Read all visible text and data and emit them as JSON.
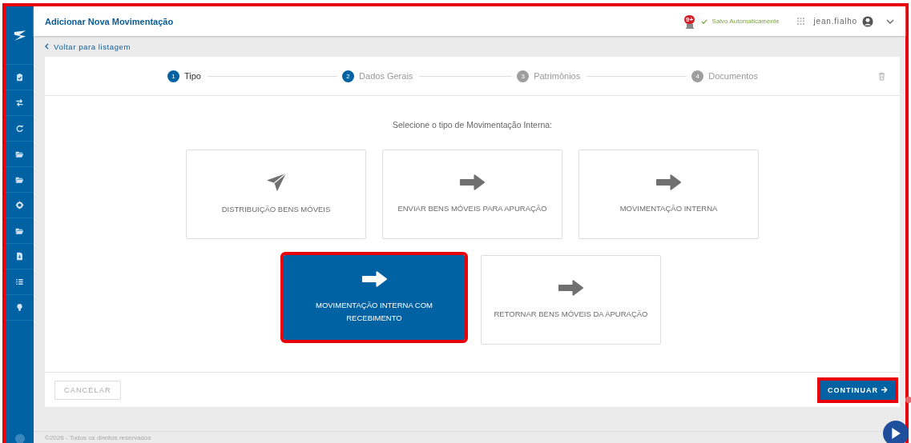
{
  "annotated": true,
  "header": {
    "title": "Adicionar Nova Movimentação",
    "notification_badge": "9+",
    "save_status": "Salvo Automaticamente",
    "username": "jean.fialho"
  },
  "back_link": "Voltar para listagem",
  "sidebar": {
    "items": [
      {
        "kind": "clipboard"
      },
      {
        "kind": "exchange"
      },
      {
        "kind": "redo"
      },
      {
        "kind": "folder"
      },
      {
        "kind": "folder"
      },
      {
        "kind": "cog"
      },
      {
        "kind": "folder"
      },
      {
        "kind": "file"
      },
      {
        "kind": "list"
      },
      {
        "kind": "bulb"
      }
    ]
  },
  "steps": [
    {
      "number": "1",
      "label": "Tipo",
      "selected": true,
      "enabled": true
    },
    {
      "number": "2",
      "label": "Dados Gerais",
      "selected": false,
      "enabled": true
    },
    {
      "number": "3",
      "label": "Patrimônios",
      "selected": false,
      "enabled": false
    },
    {
      "number": "4",
      "label": "Documentos",
      "selected": false,
      "enabled": false
    }
  ],
  "prompt": "Selecione o tipo de Movimentação Interna:",
  "types": [
    [
      {
        "label": "DISTRIBUIÇÃO BENS MÓVEIS",
        "kind": "plane",
        "selected": false,
        "highlighted": false
      },
      {
        "label": "ENVIAR BENS MÓVEIS PARA APURAÇÃO",
        "kind": "arrow",
        "selected": false,
        "highlighted": false
      },
      {
        "label": "MOVIMENTAÇÃO INTERNA",
        "kind": "arrow",
        "selected": false,
        "highlighted": false
      }
    ],
    [
      {
        "label": "MOVIMENTAÇÃO INTERNA COM RECEBIMENTO",
        "kind": "arrow",
        "selected": true,
        "highlighted": true
      },
      {
        "label": "RETORNAR BENS MÓVEIS DA APURAÇÃO",
        "kind": "arrow",
        "selected": false,
        "highlighted": false
      }
    ]
  ],
  "buttons": {
    "cancel": "CANCELAR",
    "continue": "CONTINUAR",
    "continue_highlighted": true
  },
  "footer": "©2026 - Todos os direitos reservados"
}
